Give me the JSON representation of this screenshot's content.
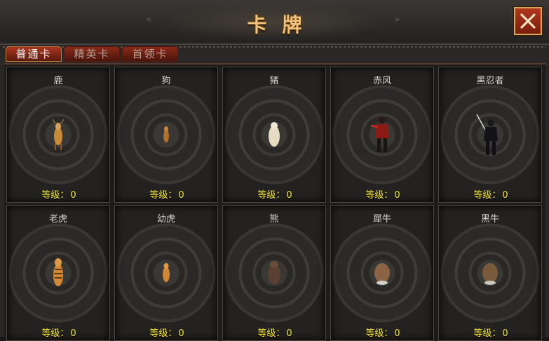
{
  "window": {
    "title": "卡牌",
    "left_arrow": "«",
    "right_arrow": "»"
  },
  "tabs": [
    {
      "label": "普通卡",
      "active": true
    },
    {
      "label": "精英卡",
      "active": false
    },
    {
      "label": "首领卡",
      "active": false
    }
  ],
  "level_label": "等级：",
  "cards": [
    {
      "name": "鹿",
      "level": "0",
      "icon": "deer-icon"
    },
    {
      "name": "狗",
      "level": "0",
      "icon": "dog-icon"
    },
    {
      "name": "猪",
      "level": "0",
      "icon": "pig-icon"
    },
    {
      "name": "赤风",
      "level": "0",
      "icon": "red-warrior-icon"
    },
    {
      "name": "黑忍者",
      "level": "0",
      "icon": "ninja-icon"
    },
    {
      "name": "老虎",
      "level": "0",
      "icon": "tiger-icon"
    },
    {
      "name": "幼虎",
      "level": "0",
      "icon": "tiger-cub-icon"
    },
    {
      "name": "熊",
      "level": "0",
      "icon": "bear-icon"
    },
    {
      "name": "犀牛",
      "level": "0",
      "icon": "rhino-icon"
    },
    {
      "name": "黑牛",
      "level": "0",
      "icon": "black-ox-icon"
    }
  ],
  "colors": {
    "title": "#f0c27a",
    "level_text": "#f5e63a",
    "close_button": "#9a2a14"
  }
}
